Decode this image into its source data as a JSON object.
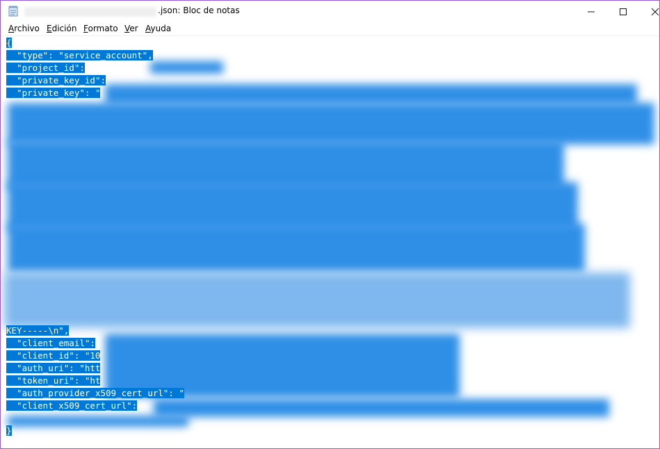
{
  "window": {
    "title": ".json: Bloc de notas"
  },
  "menu": [
    {
      "accel": "A",
      "rest": "rchivo"
    },
    {
      "accel": "E",
      "rest": "dición"
    },
    {
      "accel": "F",
      "rest": "ormato"
    },
    {
      "accel": "V",
      "rest": "er"
    },
    {
      "accel": "A",
      "rest": "yuda"
    }
  ],
  "editor": {
    "open_brace": "{",
    "lines_top": [
      "  \"type\": \"service_account\",",
      "  \"project_id\":",
      "  \"private_key_id\":",
      "  \"private_key\": \""
    ],
    "key_tail": "KEY-----\\n\",",
    "lines_bottom": [
      "  \"client_email\":",
      "  \"client_id\": \"10",
      "  \"auth_uri\": \"htt",
      "  \"token_uri\": \"ht",
      "  \"auth_provider_x509_cert_url\": \"",
      "  \"client_x509_cert_url\":"
    ],
    "close_brace": "}"
  },
  "colors": {
    "selection": "#0078d7",
    "window_border": "#9b59d0"
  }
}
